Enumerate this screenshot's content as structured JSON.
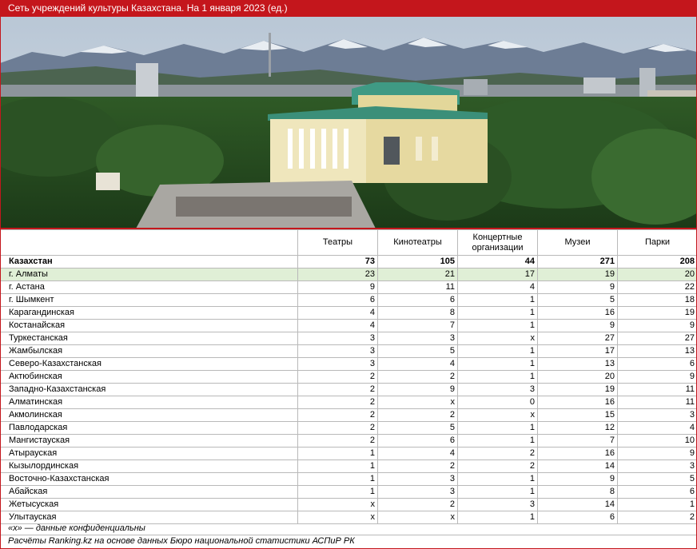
{
  "title": "Сеть учреждений культуры Казахстана. На 1 января 2023 (ед.)",
  "colors": {
    "brand": "#c4161c",
    "highlight_row": "#e0efd6"
  },
  "table": {
    "headers": [
      "",
      "Театры",
      "Кинотеатры",
      "Концертные организации",
      "Музеи",
      "Парки"
    ],
    "total": {
      "name": "Казахстан",
      "values": [
        "73",
        "105",
        "44",
        "271",
        "208"
      ]
    },
    "rows": [
      {
        "name": "г. Алматы",
        "values": [
          "23",
          "21",
          "17",
          "19",
          "20"
        ]
      },
      {
        "name": "г. Астана",
        "values": [
          "9",
          "11",
          "4",
          "9",
          "22"
        ]
      },
      {
        "name": "г. Шымкент",
        "values": [
          "6",
          "6",
          "1",
          "5",
          "18"
        ]
      },
      {
        "name": "Карагандинская",
        "values": [
          "4",
          "8",
          "1",
          "16",
          "19"
        ]
      },
      {
        "name": "Костанайская",
        "values": [
          "4",
          "7",
          "1",
          "9",
          "9"
        ]
      },
      {
        "name": "Туркестанская",
        "values": [
          "3",
          "3",
          "x",
          "27",
          "27"
        ]
      },
      {
        "name": "Жамбылская",
        "values": [
          "3",
          "5",
          "1",
          "17",
          "13"
        ]
      },
      {
        "name": "Северо-Казахстанская",
        "values": [
          "3",
          "4",
          "1",
          "13",
          "6"
        ]
      },
      {
        "name": "Актюбинская",
        "values": [
          "2",
          "2",
          "1",
          "20",
          "9"
        ]
      },
      {
        "name": "Западно-Казахстанская",
        "values": [
          "2",
          "9",
          "3",
          "19",
          "11"
        ]
      },
      {
        "name": "Алматинская",
        "values": [
          "2",
          "x",
          "0",
          "16",
          "11"
        ]
      },
      {
        "name": "Акмолинская",
        "values": [
          "2",
          "2",
          "x",
          "15",
          "3"
        ]
      },
      {
        "name": "Павлодарская",
        "values": [
          "2",
          "5",
          "1",
          "12",
          "4"
        ]
      },
      {
        "name": "Мангистауская",
        "values": [
          "2",
          "6",
          "1",
          "7",
          "10"
        ]
      },
      {
        "name": "Атырауская",
        "values": [
          "1",
          "4",
          "2",
          "16",
          "9"
        ]
      },
      {
        "name": "Кызылординская",
        "values": [
          "1",
          "2",
          "2",
          "14",
          "3"
        ]
      },
      {
        "name": "Восточно-Казахстанская",
        "values": [
          "1",
          "3",
          "1",
          "9",
          "5"
        ]
      },
      {
        "name": "Абайская",
        "values": [
          "1",
          "3",
          "1",
          "8",
          "6"
        ]
      },
      {
        "name": "Жетысуская",
        "values": [
          "x",
          "2",
          "3",
          "14",
          "1"
        ]
      },
      {
        "name": "Улытауская",
        "values": [
          "x",
          "x",
          "1",
          "6",
          "2"
        ]
      }
    ]
  },
  "footnote": "«x» — данные конфиденциальны",
  "source": "Расчёты Ranking.kz на основе данных Бюро национальной статистики АСПиР РК"
}
